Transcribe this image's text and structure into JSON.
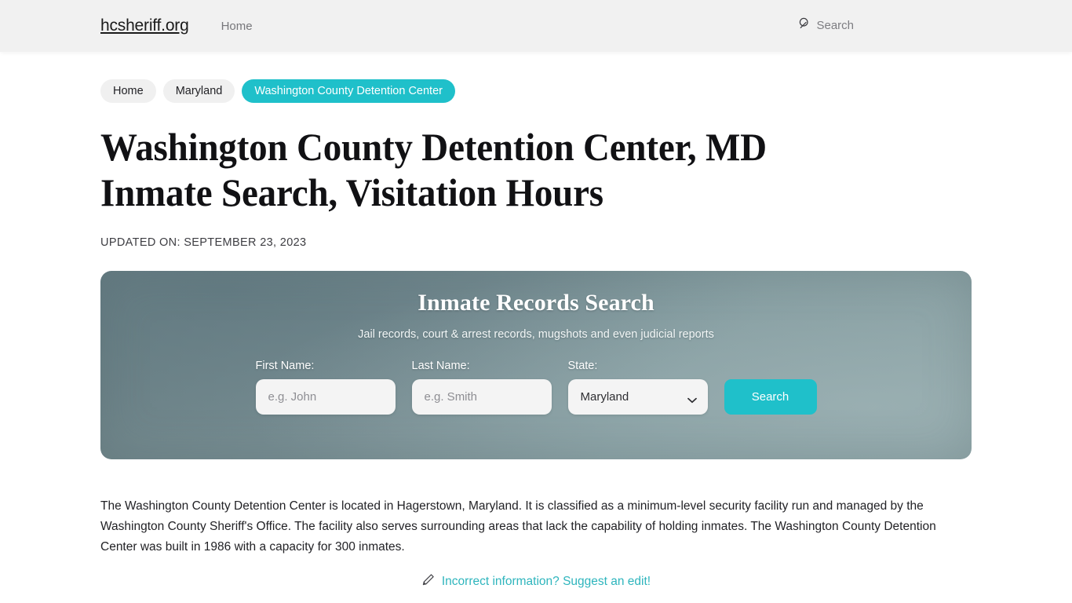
{
  "header": {
    "brand": "hcsheriff.org",
    "nav": [
      {
        "label": "Home",
        "name": "nav-home"
      }
    ],
    "search": {
      "label": "Search",
      "icon": "search-icon"
    }
  },
  "breadcrumbs": [
    {
      "label": "Home",
      "active": false
    },
    {
      "label": "Maryland",
      "active": false
    },
    {
      "label": "Washington County Detention Center",
      "active": true
    }
  ],
  "main": {
    "title": "Washington County Detention Center, MD Inmate Search, Visitation Hours",
    "updated": "UPDATED ON: SEPTEMBER 23, 2023",
    "paragraph": "The Washington County Detention Center is located in Hagerstown, Maryland. It is classified as a minimum-level security facility run and managed by the Washington County Sheriff's Office. The facility also serves surrounding areas that lack the capability of holding inmates. The Washington County Detention Center was built in 1986 with a capacity for 300 inmates.",
    "suggest_edit": {
      "icon": "pencil-icon",
      "label": "Incorrect information? Suggest an edit!"
    }
  },
  "search_panel": {
    "title": "Inmate Records Search",
    "subtitle": "Jail records, court & arrest records, mugshots and even judicial reports",
    "fields": {
      "first_name": {
        "label": "First Name:",
        "placeholder": "e.g. John",
        "value": ""
      },
      "last_name": {
        "label": "Last Name:",
        "placeholder": "e.g. Smith",
        "value": ""
      },
      "state": {
        "label": "State:",
        "selected": "Maryland",
        "options": [
          "Maryland"
        ]
      }
    },
    "submit_label": "Search"
  },
  "colors": {
    "accent_teal": "#1fc0ca",
    "link_teal": "#2eb5bd",
    "header_bg": "#f1f1f1",
    "crumb_bg": "#f0f0f0",
    "panel_dark": "#6c8287",
    "panel_light": "#8aa1a4"
  }
}
